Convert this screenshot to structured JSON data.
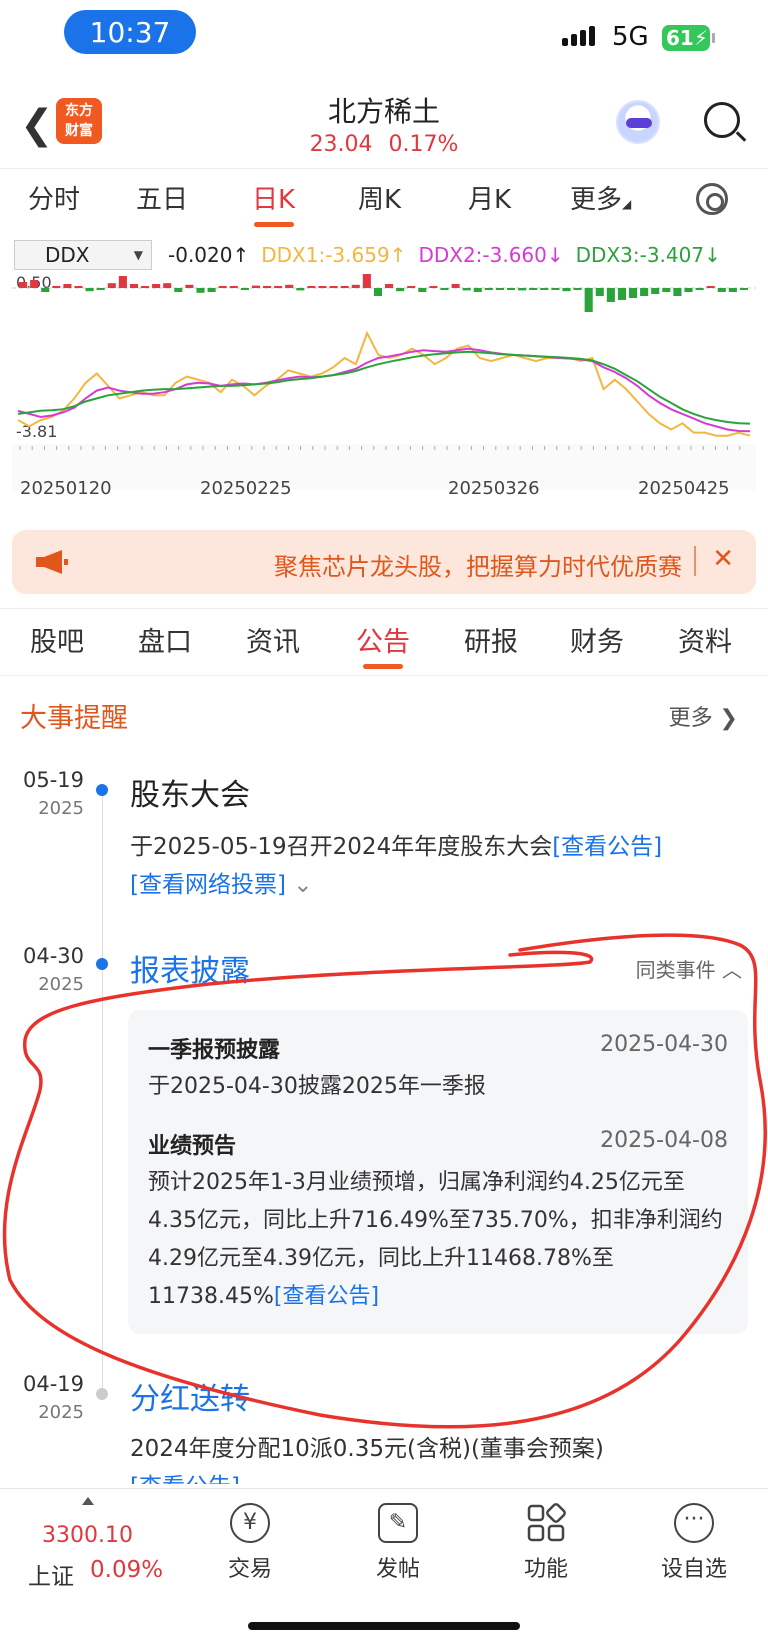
{
  "status_bar": {
    "time": "10:37",
    "network": "5G",
    "battery": "61"
  },
  "header": {
    "logo_text": "东方财富",
    "stock_name": "北方稀土",
    "price": "23.04",
    "change_pct": "0.17%"
  },
  "period_tabs": [
    "分时",
    "五日",
    "日K",
    "周K",
    "月K",
    "更多"
  ],
  "active_period": "日K",
  "indicator": {
    "selected": "DDX",
    "ddx": "-0.020↑",
    "ddx1": "DDX1:-3.659↑",
    "ddx2": "DDX2:-3.660↓",
    "ddx3": "DDX3:-3.407↓",
    "colors": {
      "ddx1": "#f4b63f",
      "ddx2": "#d63ad6",
      "ddx3": "#2aa33b"
    }
  },
  "chart_data": {
    "type": "line",
    "ylim": [
      -3.81,
      0.5
    ],
    "y_tick_labels": [
      "0.50",
      "-3.81"
    ],
    "x_tick_labels": [
      "20250120",
      "20250225",
      "20250326",
      "20250425"
    ],
    "series": [
      {
        "name": "DDX1",
        "color": "#f4b63f",
        "values": [
          -3.3,
          -3.5,
          -3.3,
          -3.2,
          -3.0,
          -2.6,
          -2.1,
          -1.8,
          -2.2,
          -2.6,
          -2.5,
          -2.4,
          -2.5,
          -2.5,
          -2.1,
          -1.9,
          -2.0,
          -2.1,
          -2.4,
          -2.0,
          -2.2,
          -2.5,
          -2.2,
          -2.0,
          -1.7,
          -1.8,
          -1.9,
          -1.8,
          -1.6,
          -1.3,
          -1.5,
          -0.5,
          -1.2,
          -1.3,
          -1.2,
          -1.0,
          -1.2,
          -1.5,
          -1.3,
          -1.0,
          -0.9,
          -1.3,
          -1.4,
          -1.3,
          -1.2,
          -1.3,
          -1.4,
          -1.3,
          -1.3,
          -1.3,
          -1.4,
          -1.3,
          -2.3,
          -2.0,
          -2.3,
          -2.7,
          -3.1,
          -3.4,
          -3.6,
          -3.4,
          -3.7,
          -3.7,
          -3.8,
          -3.8,
          -3.7,
          -3.8
        ]
      },
      {
        "name": "DDX2",
        "color": "#d63ad6",
        "values": [
          -3.0,
          -3.1,
          -3.2,
          -3.15,
          -3.05,
          -2.9,
          -2.6,
          -2.35,
          -2.25,
          -2.35,
          -2.4,
          -2.45,
          -2.45,
          -2.4,
          -2.3,
          -2.15,
          -2.1,
          -2.12,
          -2.2,
          -2.15,
          -2.12,
          -2.15,
          -2.1,
          -2.02,
          -1.95,
          -1.9,
          -1.92,
          -1.9,
          -1.85,
          -1.75,
          -1.65,
          -1.45,
          -1.3,
          -1.25,
          -1.18,
          -1.1,
          -1.05,
          -1.08,
          -1.1,
          -1.05,
          -1.0,
          -1.05,
          -1.12,
          -1.17,
          -1.2,
          -1.22,
          -1.25,
          -1.27,
          -1.3,
          -1.32,
          -1.35,
          -1.4,
          -1.6,
          -1.75,
          -1.95,
          -2.2,
          -2.5,
          -2.75,
          -2.95,
          -3.1,
          -3.25,
          -3.4,
          -3.5,
          -3.6,
          -3.65,
          -3.66
        ]
      },
      {
        "name": "DDX3",
        "color": "#2aa33b",
        "values": [
          -3.1,
          -3.05,
          -3.0,
          -2.98,
          -2.95,
          -2.85,
          -2.7,
          -2.6,
          -2.5,
          -2.45,
          -2.4,
          -2.35,
          -2.32,
          -2.3,
          -2.3,
          -2.28,
          -2.25,
          -2.22,
          -2.2,
          -2.2,
          -2.18,
          -2.15,
          -2.12,
          -2.08,
          -2.02,
          -1.98,
          -1.95,
          -1.9,
          -1.85,
          -1.8,
          -1.72,
          -1.6,
          -1.5,
          -1.42,
          -1.35,
          -1.28,
          -1.22,
          -1.18,
          -1.15,
          -1.12,
          -1.1,
          -1.12,
          -1.15,
          -1.18,
          -1.2,
          -1.22,
          -1.24,
          -1.26,
          -1.28,
          -1.3,
          -1.33,
          -1.38,
          -1.5,
          -1.65,
          -1.85,
          -2.05,
          -2.3,
          -2.55,
          -2.75,
          -2.95,
          -3.1,
          -3.22,
          -3.3,
          -3.36,
          -3.4,
          -3.41
        ]
      }
    ],
    "bars": [
      0.15,
      0.2,
      -0.1,
      0.05,
      0.1,
      0.05,
      -0.08,
      -0.05,
      0.12,
      0.3,
      0.1,
      0.05,
      0.1,
      0.12,
      -0.1,
      0.08,
      -0.12,
      -0.1,
      0.05,
      0.05,
      -0.05,
      0.06,
      0.05,
      0.05,
      0.08,
      -0.06,
      0.05,
      0.04,
      0.05,
      0.05,
      0.08,
      0.45,
      -0.2,
      0.1,
      -0.08,
      0.05,
      -0.1,
      0.05,
      -0.05,
      0.1,
      -0.06,
      -0.1,
      -0.05,
      -0.04,
      -0.05,
      -0.06,
      -0.04,
      -0.05,
      -0.05,
      -0.08,
      -0.05,
      -0.6,
      -0.2,
      -0.35,
      -0.3,
      -0.25,
      -0.2,
      -0.15,
      -0.1,
      -0.2,
      -0.1,
      -0.05,
      0.05,
      -0.1,
      -0.1,
      -0.05
    ],
    "grid": false
  },
  "banner": {
    "text": "聚焦芯片龙头股，把握算力时代优质赛",
    "close": "✕"
  },
  "info_tabs": [
    "股吧",
    "盘口",
    "资讯",
    "公告",
    "研报",
    "财务",
    "资料"
  ],
  "active_info_tab": "公告",
  "events_section": {
    "title": "大事提醒",
    "more": "更多 ❯"
  },
  "events": [
    {
      "date": "05-19",
      "year": "2025",
      "title": "股东大会",
      "body": "于2025-05-19召开2024年年度股东大会",
      "link1": "[查看公告]",
      "link2": "[查看网络投票]"
    },
    {
      "date": "04-30",
      "year": "2025",
      "title": "报表披露",
      "same_type": "同类事件 ︿",
      "items": [
        {
          "title": "一季报预披露",
          "date": "2025-04-30",
          "text": "于2025-04-30披露2025年一季报"
        },
        {
          "title": "业绩预告",
          "date": "2025-04-08",
          "text": "预计2025年1-3月业绩预增，归属净利润约4.25亿元至4.35亿元，同比上升716.49%至735.70%，扣非净利润约4.29亿元至4.39亿元，同比上升11468.78%至11738.45%",
          "link": "[查看公告]"
        }
      ]
    },
    {
      "date": "04-19",
      "year": "2025",
      "title": "分红送转",
      "body": "2024年度分配10派0.35元(含税)(董事会预案)",
      "link1": "[查看公告]"
    }
  ],
  "bottom_nav": {
    "index_value": "3300.10",
    "index_name": "上证",
    "index_pct": "0.09%",
    "items": [
      "交易",
      "发帖",
      "功能",
      "设自选"
    ]
  }
}
